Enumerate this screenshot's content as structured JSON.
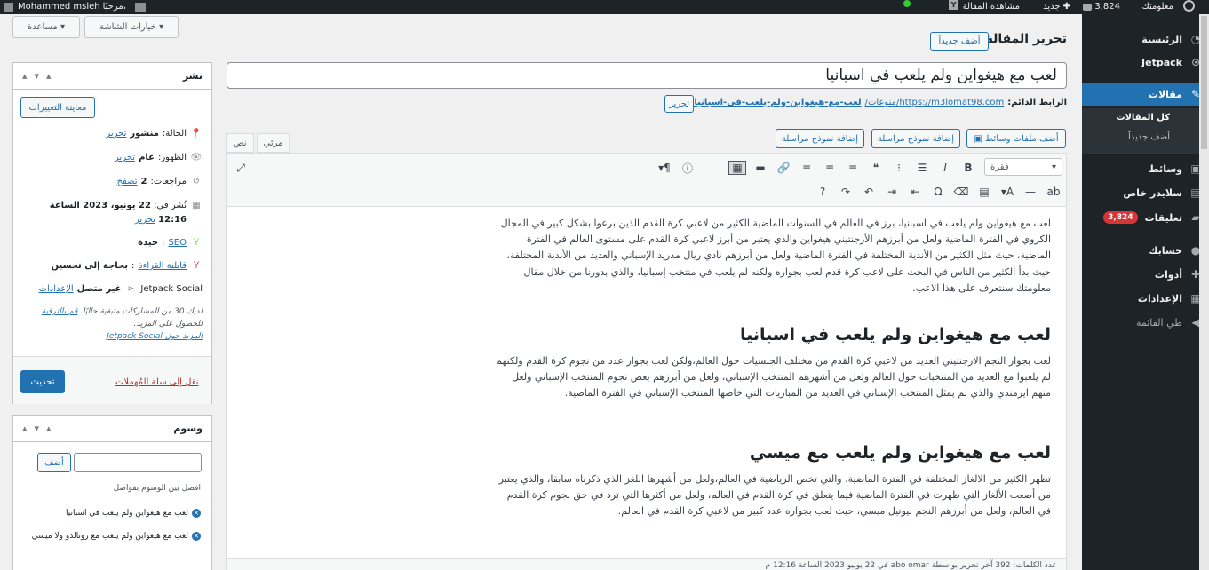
{
  "adminbar": {
    "wp_logo": "wordpress-icon",
    "site": "معلومتك",
    "comments": "3,824",
    "new": "جديد",
    "view": "مشاهدة المقالة",
    "greeting": "مرحبًا، ",
    "user": "Mohammed msleh"
  },
  "sidebar": {
    "items": [
      {
        "label": "الرئيسية",
        "icon": "dashboard-icon"
      },
      {
        "label": "Jetpack",
        "icon": "jetpack-icon"
      },
      {
        "label": "مقالات",
        "icon": "pin-icon"
      },
      {
        "label": "وسائط",
        "icon": "media-icon"
      },
      {
        "label": "سلايدر خاص",
        "icon": "slider-icon"
      },
      {
        "label": "تعليقات",
        "icon": "comments-icon",
        "badge": "3,824"
      },
      {
        "label": "حسابك",
        "icon": "user-icon"
      },
      {
        "label": "أدوات",
        "icon": "tools-icon"
      },
      {
        "label": "الإعدادات",
        "icon": "settings-icon"
      },
      {
        "label": "طي القائمة",
        "icon": "collapse-icon"
      }
    ],
    "submenu": [
      "كل المقالات",
      "أضف جديداً"
    ]
  },
  "header": {
    "screen_options": "خيارات الشاشة ▾",
    "help": "مساعدة ▾",
    "title": "تحرير المقالة",
    "add_new": "أضف جديداً"
  },
  "post": {
    "title": "لعب مع هيغواين ولم يلعب في اسبانيا",
    "permalink_label": "الرابط الدائم:",
    "permalink_base": "https://m3lomat98.com/منوعات/",
    "permalink_slug": "لعب-مع-هيغواين-ولم-يلعب-في-اسبانيا/",
    "permalink_edit": "تحرير"
  },
  "editor": {
    "add_media": "أضف ملفات وسائط",
    "add_form1": "إضافة نموذج مراسلة",
    "add_form2": "إضافة نموذج مراسلة",
    "tab_visual": "مرئي",
    "tab_text": "نص",
    "format": "فقرة",
    "p1": "لعب مع هيغواين ولم يلعب في اسبانيا، برز في العالم في السنوات الماضية الكثير من لاعبي كرة القدم الذين برعوا بشكل كبير في المجال الكروي في الفترة الماضية ولعل من أبرزهم الأرجنتيني هيغواين والذي يعتبر من أبرز لاعبي كرة القدم على مستوى العالم في الفترة الماضية، حيث مثل الكثير من الأندية المختلفة في الفترة الماضية ولعل من أبرزهم نادي ريال مدريد الإسباني والعديد من الأندية المختلفة، حيث بدأ الكثير من الناس في البحث على لاعب كرة قدم لعب بجواره ولكنه لم يلعب في منتخب إسبانيا، والذي بدورنا من خلال مقال معلومتك سنتعرف على هذا الاعب.",
    "h1": "لعب مع هيغواين ولم يلعب في اسبانيا",
    "p2": "لعب بجوار النجم الارجنتيني العديد من لاعبي كرة القدم من مختلف الجنسيات حول العالم،ولكن لعب بجوار عدد من نجوم كرة القدم ولكنهم لم يلعبوا مع العديد من المنتخبات حول العالم ولعل من أشهرهم المنتخب الإسباني، ولعل من أبرزهم بعض نجوم المنتخب الإسباني ولعل منهم ايرمندي والذي لم يمثل المنتخب الإسباني في العديد من المباريات التي خاضها المنتخب الإسباني في الفترة الماضية.",
    "h2": "لعب مع هيغواين ولم يلعب مع ميسي",
    "p3": "تظهر الكثير من الالغاز المختلفة في الفترة الماضية، والتي تخص الرياضية في العالم،ولعل من أشهرها اللغز الذي ذكرناه سابقا، والذي يعتبر من أصعب الألغاز التي ظهرت في الفترة الماضية فيما يتعلق في كرة القدم في العالم، ولعل من أكثرها التي ترد في حق نجوم كرة القدم في العالم، ولعل من أبرزهم النجم ليونيل ميسي، حيث لعب بجواره عدد كبير من لاعبي كرة القدم في العالم.",
    "status_bar": "عدد الكلمات: 392    آخر تحرير بواسطة abo omar في 22 يونيو 2023 الساعة 12:16 م"
  },
  "publish": {
    "title": "نشر",
    "preview": "معاينة التغييرات",
    "status_label": "الحالة:",
    "status": "منشور",
    "status_edit": "تحرير",
    "visibility_label": "الظهور:",
    "visibility": "عام",
    "visibility_edit": "تحرير",
    "revisions_label": "مراجعات:",
    "revisions": "2",
    "revisions_link": "تصفح",
    "published_label": "نُشر في:",
    "published_date": "22 يونيو، 2023 الساعة 12:16",
    "published_edit": "تحرير",
    "seo_label": "SEO",
    "seo_value": "جيدة",
    "read_label": "قابلية القراءة",
    "read_value": "بحاجة إلى تحسين",
    "social_label": "Jetpack Social",
    "social_value": "غير متصل",
    "social_link": "الإعدادات",
    "note1": "لديك 30 من المشاركات متبقية حاليًا.",
    "note_link": "قم بالترقية",
    "note2": "للحصول على المزيد.",
    "note3": "المزيد حول Jetpack Social",
    "trash": "نقل إلى سلة المُهملات",
    "update": "تحديث"
  },
  "tags": {
    "title": "وسوم",
    "add": "أضف",
    "hint": "افصل بين الوسوم بفواصل",
    "items": [
      "لعب مع هيغواين ولم يلعب في اسبانيا",
      "لعب مع هيغواين ولم يلعب مع رونالدو ولا ميسي"
    ]
  }
}
